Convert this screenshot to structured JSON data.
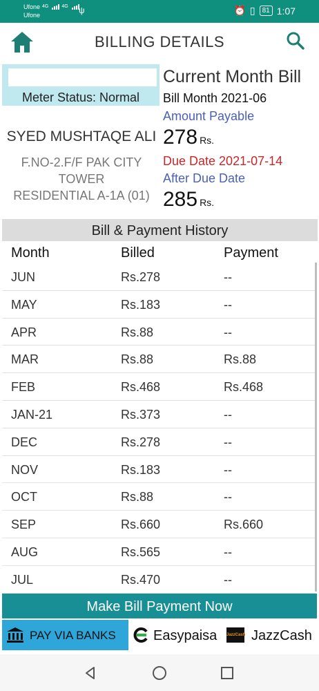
{
  "status_bar": {
    "carrier_1": "Ufone",
    "carrier_2": "Ufone",
    "network_1": "4G",
    "network_2": "4G",
    "battery": "81",
    "time": "1:07"
  },
  "header": {
    "title": "BILLING DETAILS",
    "home_icon": "home-icon",
    "search_icon": "search-icon"
  },
  "meter": {
    "input_value": "",
    "status": "Meter Status: Normal"
  },
  "customer": {
    "name": "SYED MUSHTAQE ALI",
    "address_line_1": "F.NO-2.F/F PAK CITY TOWER",
    "address_line_2": "RESIDENTIAL A-1A (01)"
  },
  "bill": {
    "title": "Current Month Bill",
    "month": "Bill Month 2021-06",
    "amount_label": "Amount Payable",
    "amount": "278",
    "currency": "Rs.",
    "due_date": "Due Date 2021-07-14",
    "after_due_label": "After Due Date",
    "after_due_amount": "285",
    "after_due_currency": "Rs."
  },
  "history": {
    "title": "Bill & Payment History",
    "columns": [
      "Month",
      "Billed",
      "Payment"
    ],
    "rows": [
      {
        "month": "JUN",
        "billed": "Rs.278",
        "payment": "--"
      },
      {
        "month": "MAY",
        "billed": "Rs.183",
        "payment": "--"
      },
      {
        "month": "APR",
        "billed": "Rs.88",
        "payment": "--"
      },
      {
        "month": "MAR",
        "billed": "Rs.88",
        "payment": "Rs.88"
      },
      {
        "month": "FEB",
        "billed": "Rs.468",
        "payment": "Rs.468"
      },
      {
        "month": "JAN-21",
        "billed": "Rs.373",
        "payment": "--"
      },
      {
        "month": "DEC",
        "billed": "Rs.278",
        "payment": "--"
      },
      {
        "month": "NOV",
        "billed": "Rs.183",
        "payment": "--"
      },
      {
        "month": "OCT",
        "billed": "Rs.88",
        "payment": "--"
      },
      {
        "month": "SEP",
        "billed": "Rs.660",
        "payment": "Rs.660"
      },
      {
        "month": "AUG",
        "billed": "Rs.565",
        "payment": "--"
      },
      {
        "month": "JUL",
        "billed": "Rs.470",
        "payment": "--"
      }
    ]
  },
  "payment": {
    "cta": "Make Bill Payment Now",
    "banks_label": "PAY VIA BANKS",
    "easypaisa_label": "Easypaisa",
    "jazzcash_label": "JazzCash",
    "jazzcash_logo_text": "JazzCash"
  },
  "colors": {
    "status_bar": "#0f8f7d",
    "meter_box": "#bfe9ee",
    "link_blue": "#4a5fb6",
    "due_red": "#c62828",
    "cta_teal": "#178f94",
    "banks_blue": "#2ea6d9"
  }
}
